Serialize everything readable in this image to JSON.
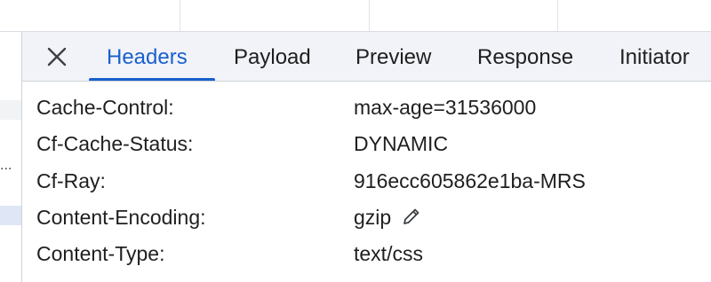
{
  "tabs": [
    {
      "label": "Headers",
      "active": true
    },
    {
      "label": "Payload",
      "active": false
    },
    {
      "label": "Preview",
      "active": false
    },
    {
      "label": "Response",
      "active": false
    },
    {
      "label": "Initiator",
      "active": false
    }
  ],
  "left_list": {
    "ellipsis": "..."
  },
  "headers": [
    {
      "name": "Cache-Control:",
      "value": "max-age=31536000"
    },
    {
      "name": "Cf-Cache-Status:",
      "value": "DYNAMIC"
    },
    {
      "name": "Cf-Ray:",
      "value": "916ecc605862e1ba-MRS"
    },
    {
      "name": "Content-Encoding:",
      "value": "gzip",
      "editable": true
    },
    {
      "name": "Content-Type:",
      "value": "text/css"
    }
  ],
  "icons": {
    "close": "close-icon",
    "edit": "pencil-icon"
  },
  "colors": {
    "accent": "#1a5fcd",
    "tabbar_bg": "#f1f3f8",
    "text": "#1f1f1f"
  }
}
